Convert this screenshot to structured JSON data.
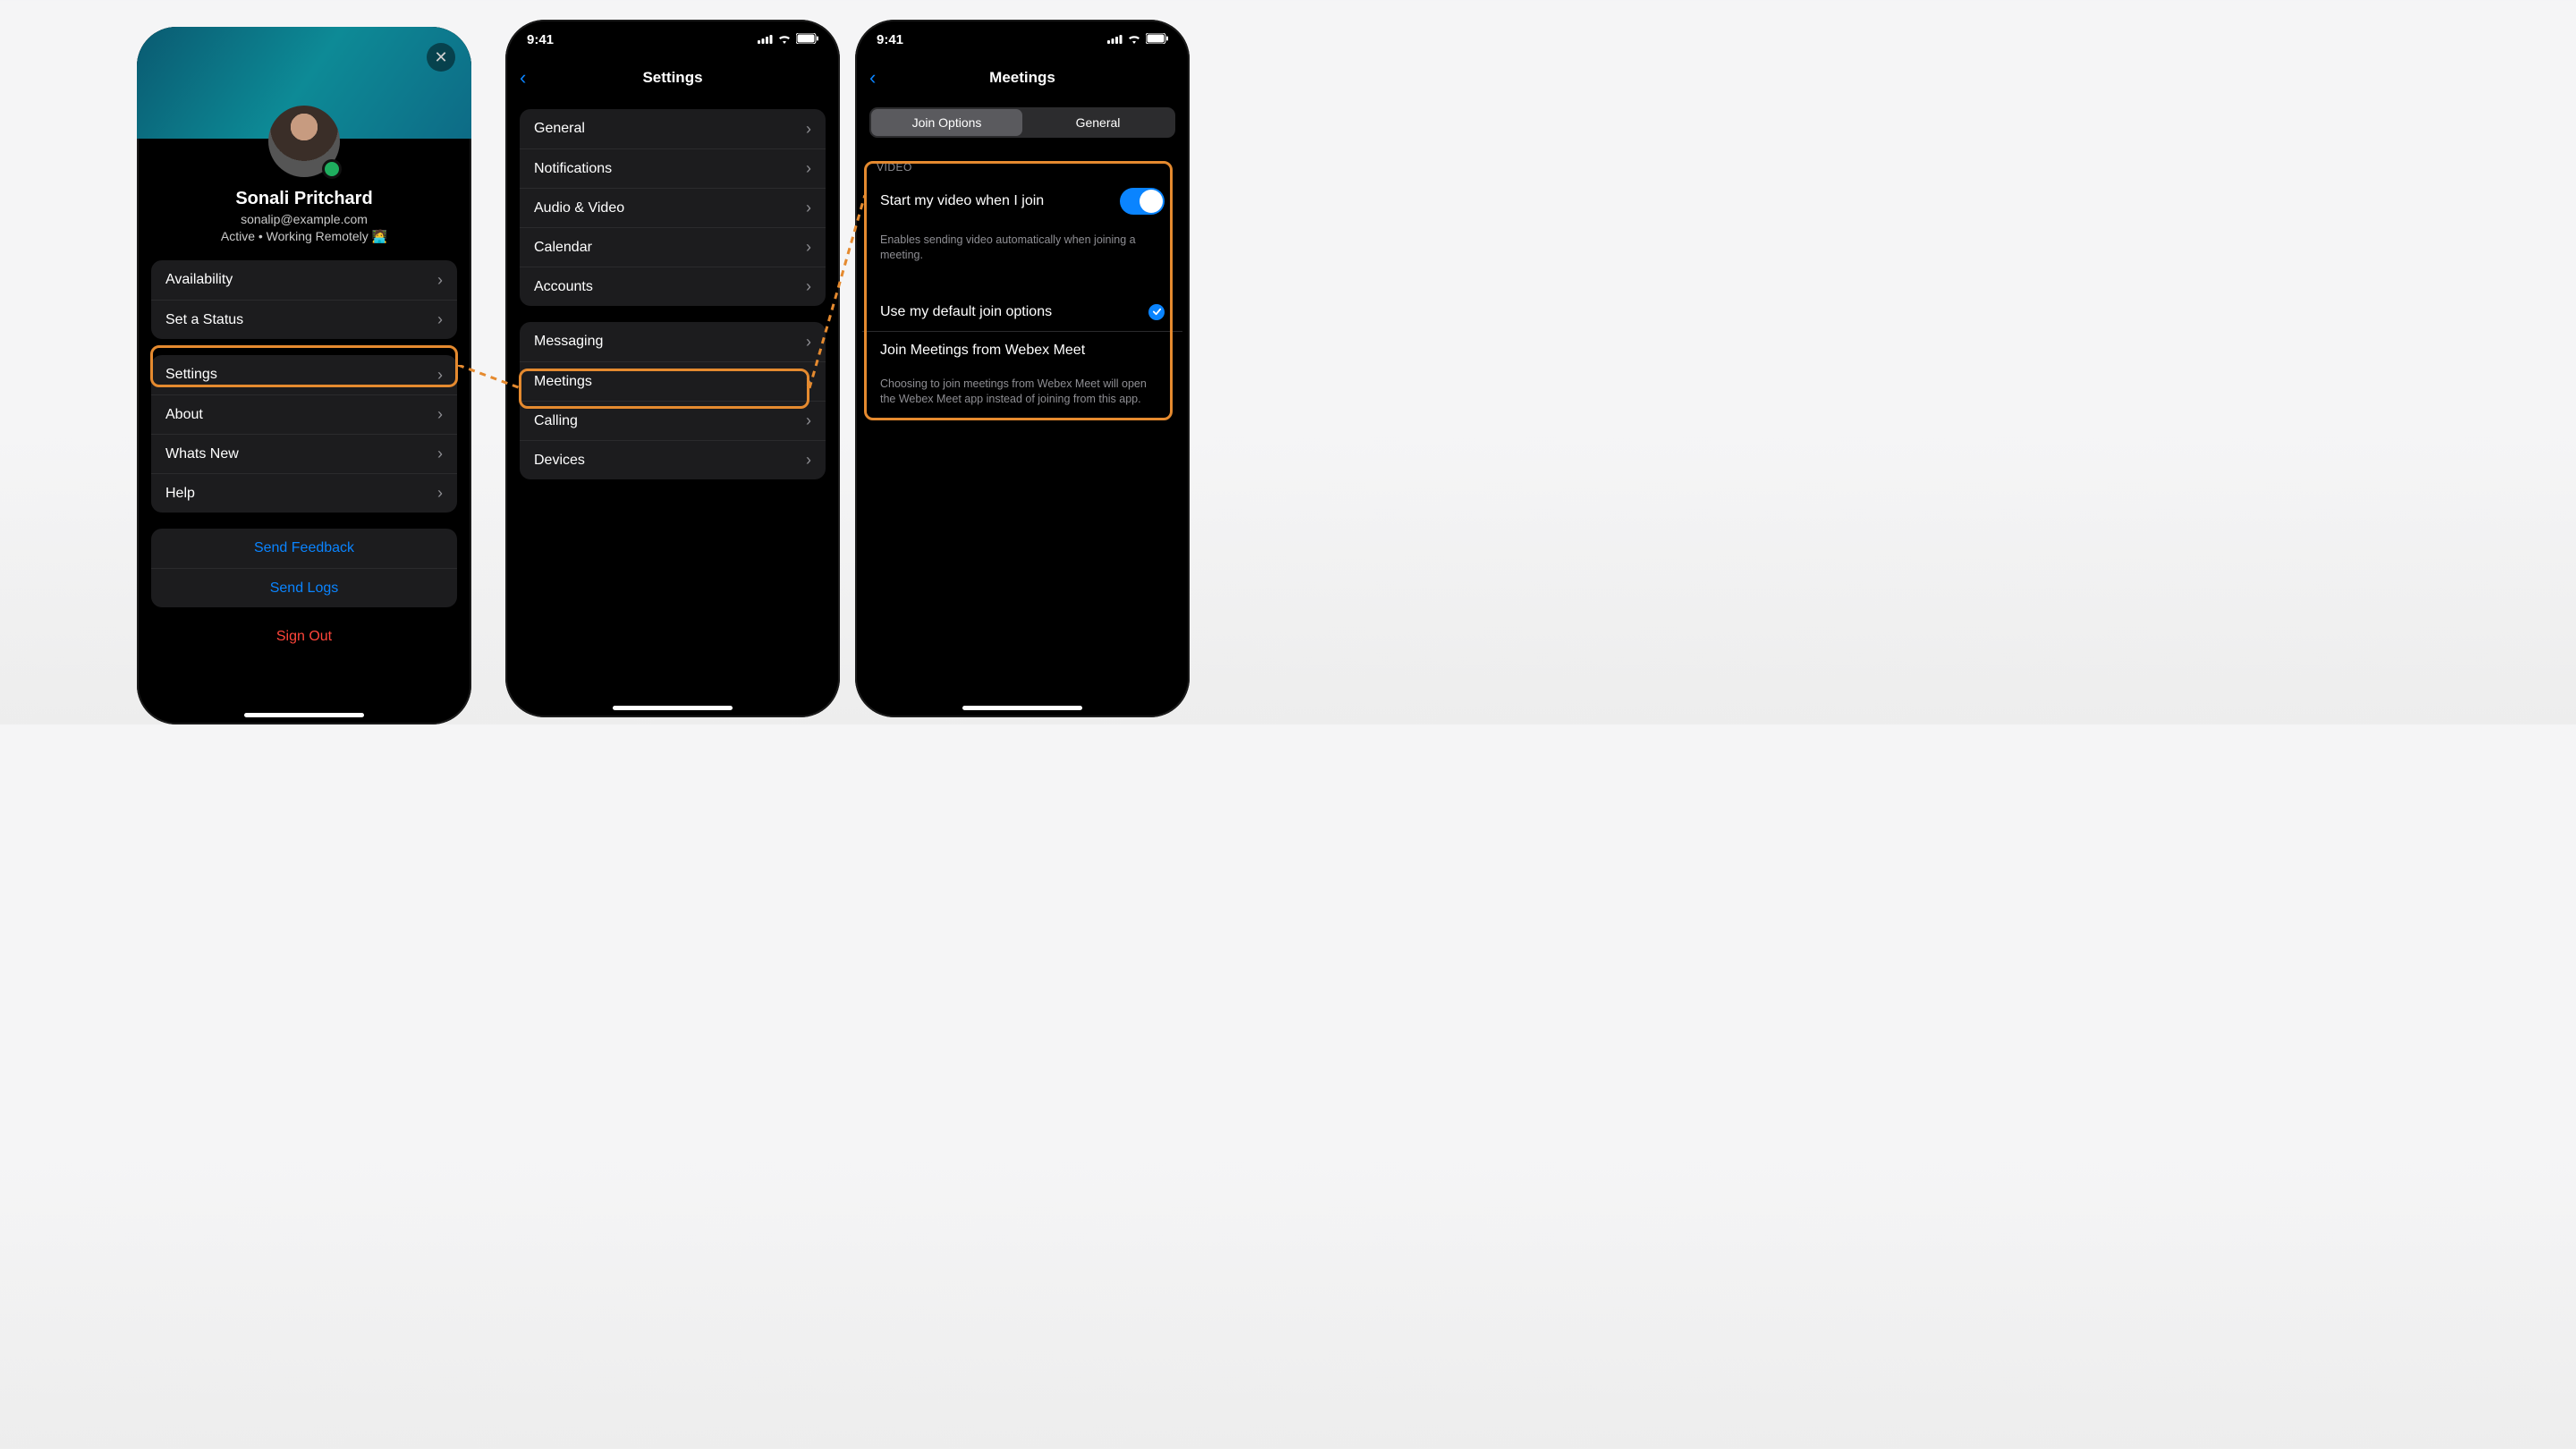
{
  "screen1": {
    "close_aria": "Close",
    "name": "Sonali Pritchard",
    "email": "sonalip@example.com",
    "status": "Active • Working Remotely 🧑‍💻",
    "group1": [
      {
        "label": "Availability"
      },
      {
        "label": "Set a Status"
      }
    ],
    "group2": [
      {
        "label": "Settings"
      },
      {
        "label": "About"
      },
      {
        "label": "Whats New"
      },
      {
        "label": "Help"
      }
    ],
    "group3": [
      {
        "label": "Send Feedback"
      },
      {
        "label": "Send Logs"
      }
    ],
    "signout": "Sign Out"
  },
  "screen2": {
    "time": "9:41",
    "title": "Settings",
    "group1": [
      {
        "label": "General"
      },
      {
        "label": "Notifications"
      },
      {
        "label": "Audio & Video"
      },
      {
        "label": "Calendar"
      },
      {
        "label": "Accounts"
      }
    ],
    "group2": [
      {
        "label": "Messaging"
      },
      {
        "label": "Meetings"
      },
      {
        "label": "Calling"
      },
      {
        "label": "Devices"
      }
    ]
  },
  "screen3": {
    "time": "9:41",
    "title": "Meetings",
    "seg": {
      "a": "Join Options",
      "b": "General"
    },
    "video_section": "VIDEO",
    "start_video": "Start my video when I join",
    "start_video_desc": "Enables sending video automatically when joining a meeting.",
    "use_default": "Use my default join options",
    "join_webex": "Join Meetings from Webex Meet",
    "join_webex_desc": "Choosing to join meetings from Webex Meet will open the Webex Meet app instead of joining from this app."
  },
  "colors": {
    "accent": "#0a84ff",
    "highlight": "#e58a2f"
  }
}
